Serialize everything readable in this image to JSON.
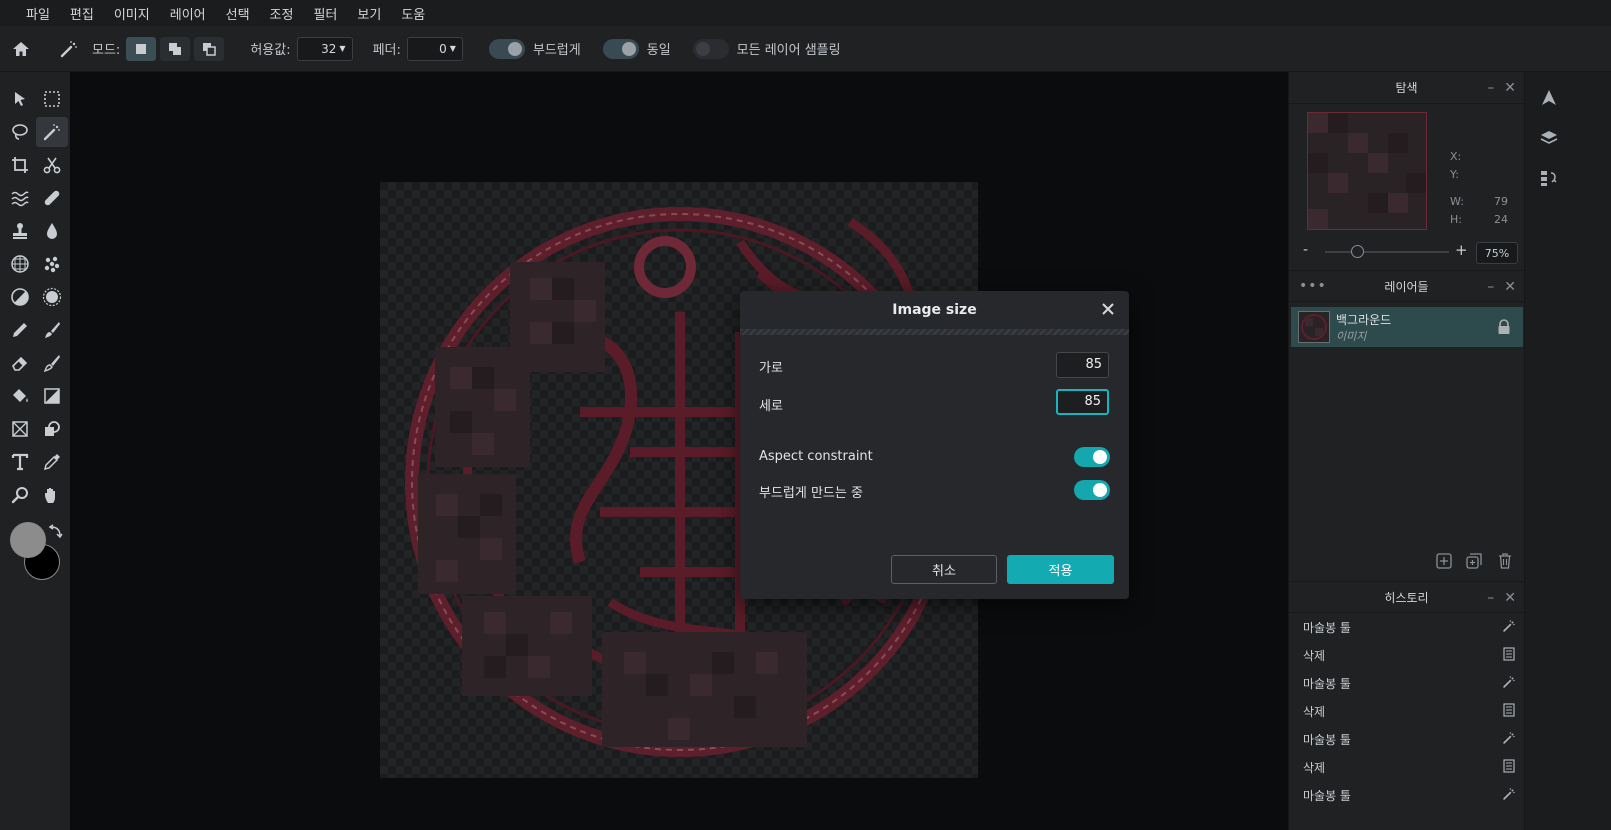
{
  "menu": [
    "파일",
    "편집",
    "이미지",
    "레이어",
    "선택",
    "조정",
    "필터",
    "보기",
    "도움"
  ],
  "options": {
    "mode_label": "모드:",
    "tolerance_label": "허용값:",
    "tolerance_value": "32",
    "feather_label": "페더:",
    "feather_value": "0",
    "smooth_label": "부드럽게",
    "contiguous_label": "동일",
    "sample_all_label": "모든 레이어 샘플링"
  },
  "navigator": {
    "title": "탐색",
    "x_label": "X:",
    "y_label": "Y:",
    "w_label": "W:",
    "w_value": "79",
    "h_label": "H:",
    "h_value": "24",
    "zoom_minus": "-",
    "zoom_plus": "+",
    "zoom_value": "75%"
  },
  "layers": {
    "title": "레이어들",
    "items": [
      {
        "name": "백그라운드",
        "type": "이미지"
      }
    ]
  },
  "history": {
    "title": "히스토리",
    "items": [
      "마술봉 툴",
      "삭제",
      "마술봉 툴",
      "삭제",
      "마술봉 툴",
      "삭제",
      "마술봉 툴"
    ]
  },
  "dialog": {
    "title": "Image size",
    "width_label": "가로",
    "width_value": "85",
    "height_label": "세로",
    "height_value": "85",
    "aspect_label": "Aspect constraint",
    "smooth_label": "부드럽게 만드는 중",
    "cancel_label": "취소",
    "apply_label": "적용"
  },
  "colors": {
    "accent": "#13aab1",
    "foreground_swatch": "#8c8c8c",
    "background_swatch": "#000000"
  }
}
